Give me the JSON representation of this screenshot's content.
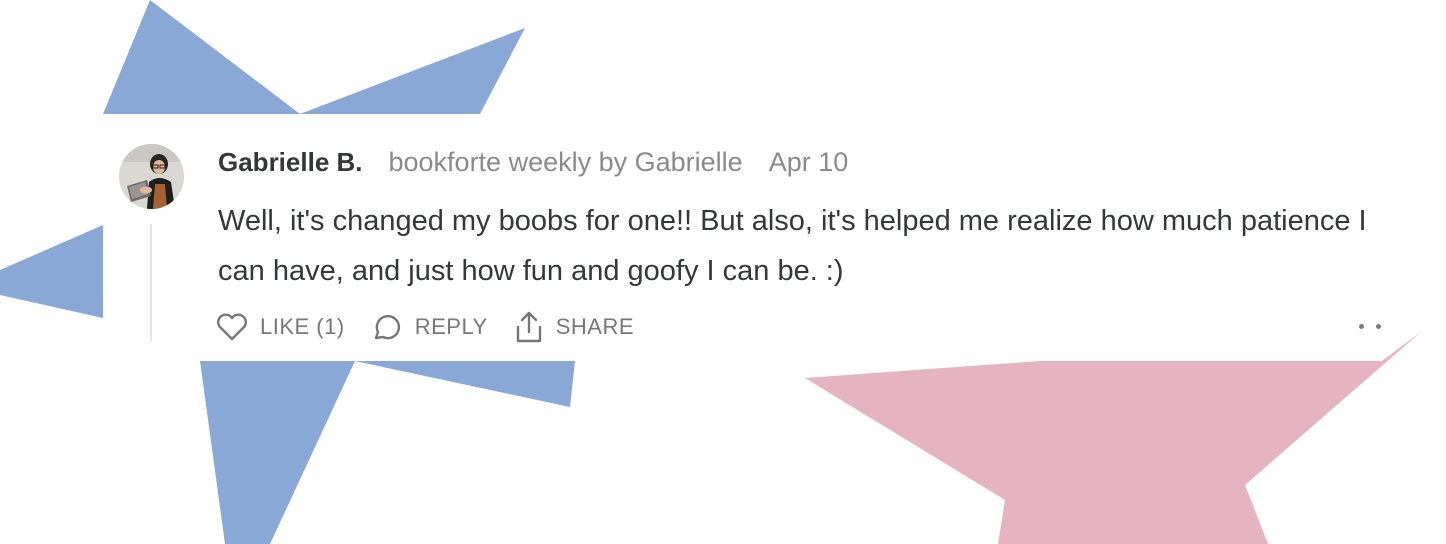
{
  "comment": {
    "author": "Gabrielle B.",
    "publication": "bookforte weekly by Gabrielle",
    "date": "Apr 10",
    "body": "Well, it's changed my boobs for one!! But also, it's helped me realize how much patience I can have, and just how fun and goofy I can be. :)",
    "avatar_icon": "user-avatar-photo"
  },
  "actions": {
    "like_label": "LIKE (1)",
    "reply_label": "REPLY",
    "share_label": "SHARE",
    "like_icon": "heart-icon",
    "reply_icon": "speech-bubble-icon",
    "share_icon": "share-upload-icon",
    "more_icon": "ellipsis-icon"
  },
  "colors": {
    "text_primary": "#363737",
    "text_secondary": "#8a8a8a",
    "action_gray": "#777777",
    "star_blue": "#8aa8d6",
    "star_pink": "#e6b3c1"
  }
}
